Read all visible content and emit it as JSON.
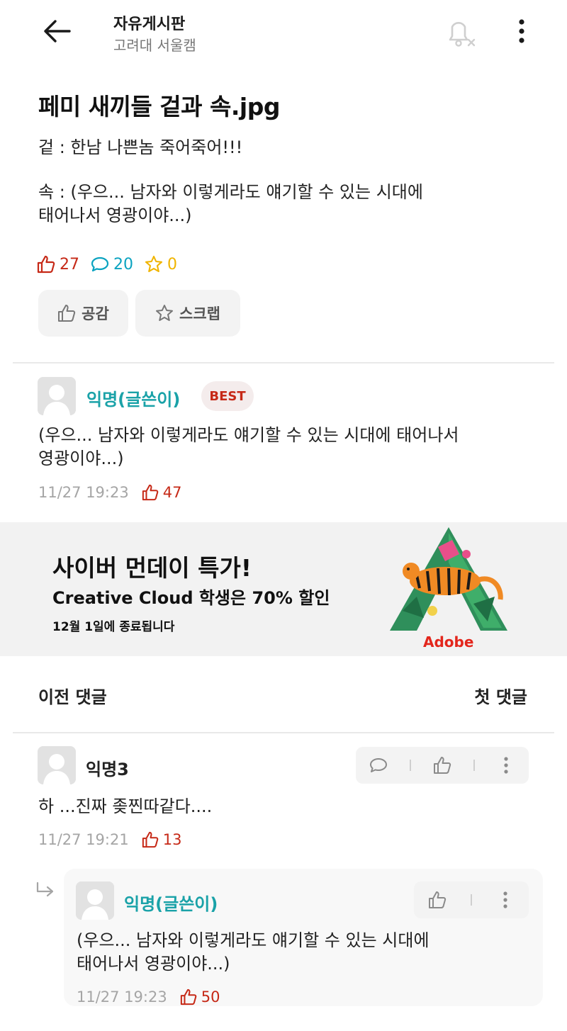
{
  "header": {
    "title": "자유게시판",
    "subtitle": "고려대 서울캠"
  },
  "post": {
    "title": "페미 새끼들 겉과 속.jpg",
    "body_lines": [
      "겉 : 한남 나쁜놈 죽어죽어!!!",
      "속 : (우으... 남자와 이렇게라도 얘기할 수 있는 시대에",
      "태어나서 영광이야...)"
    ],
    "likes": "27",
    "comments": "20",
    "scraps": "0",
    "like_button": "공감",
    "scrap_button": "스크랩"
  },
  "best_comment": {
    "author": "익명(글쓴이)",
    "badge": "BEST",
    "lines": [
      "(우으... 남자와 이렇게라도 얘기할 수 있는 시대에 태어나서",
      "영광이야...)"
    ],
    "time": "11/27 19:23",
    "likes": "47"
  },
  "ad": {
    "headline": "사이버 먼데이 특가!",
    "subline": "Creative Cloud 학생은 70% 할인",
    "detail": "12월 1일에 종료됩니다",
    "brand": "Adobe",
    "brand_color": "#e3261c"
  },
  "comment_nav": {
    "previous": "이전 댓글",
    "first": "첫 댓글"
  },
  "comments": [
    {
      "author": "익명3",
      "lines": [
        "하 ...진짜 좆찐따같다...."
      ],
      "time": "11/27 19:21",
      "likes": "13"
    }
  ],
  "replies": [
    {
      "author": "익명(글쓴이)",
      "lines": [
        "(우으... 남자와 이렇게라도 얘기할 수 있는 시대에",
        "태어나서 영광이야...)"
      ],
      "time": "11/27 19:23",
      "likes": "50"
    }
  ],
  "colors": {
    "accent_red": "#c62917",
    "comment_teal": "#0ba3c0",
    "scrap_yellow": "#f0b400",
    "author_teal": "#1aa2a8"
  },
  "icons": [
    "back-arrow-icon",
    "bell-off-icon",
    "more-vertical-icon",
    "thumbs-up-icon",
    "comment-icon",
    "star-icon",
    "reply-arrow-icon"
  ]
}
